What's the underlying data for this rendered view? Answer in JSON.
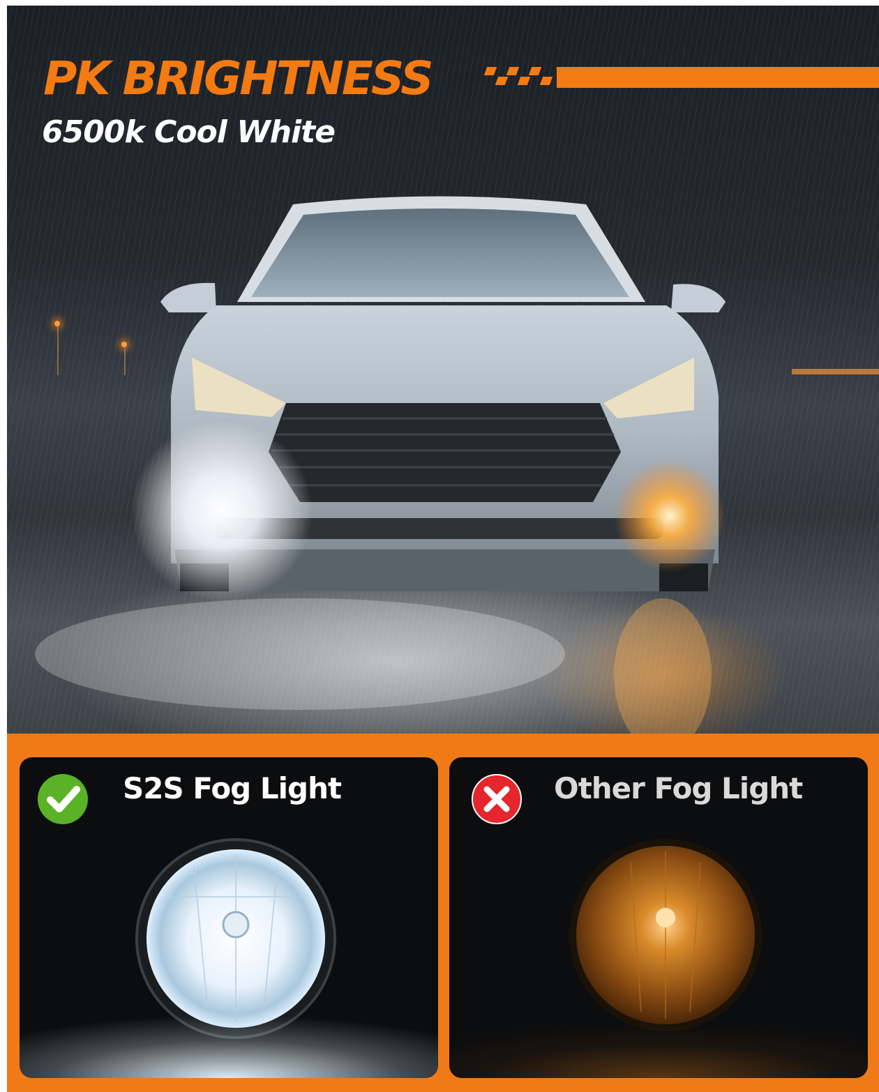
{
  "hero": {
    "headline": "PK BRIGHTNESS",
    "subline": "6500k Cool White"
  },
  "comparison": {
    "left": {
      "title": "S2S Fog Light",
      "icon": "check-icon",
      "lamp_color": "cool-white"
    },
    "right": {
      "title": "Other Fog Light",
      "icon": "x-icon",
      "lamp_color": "amber"
    }
  },
  "colors": {
    "accent": "#f47a12",
    "check_green": "#5ab226",
    "x_red": "#e5262c"
  }
}
